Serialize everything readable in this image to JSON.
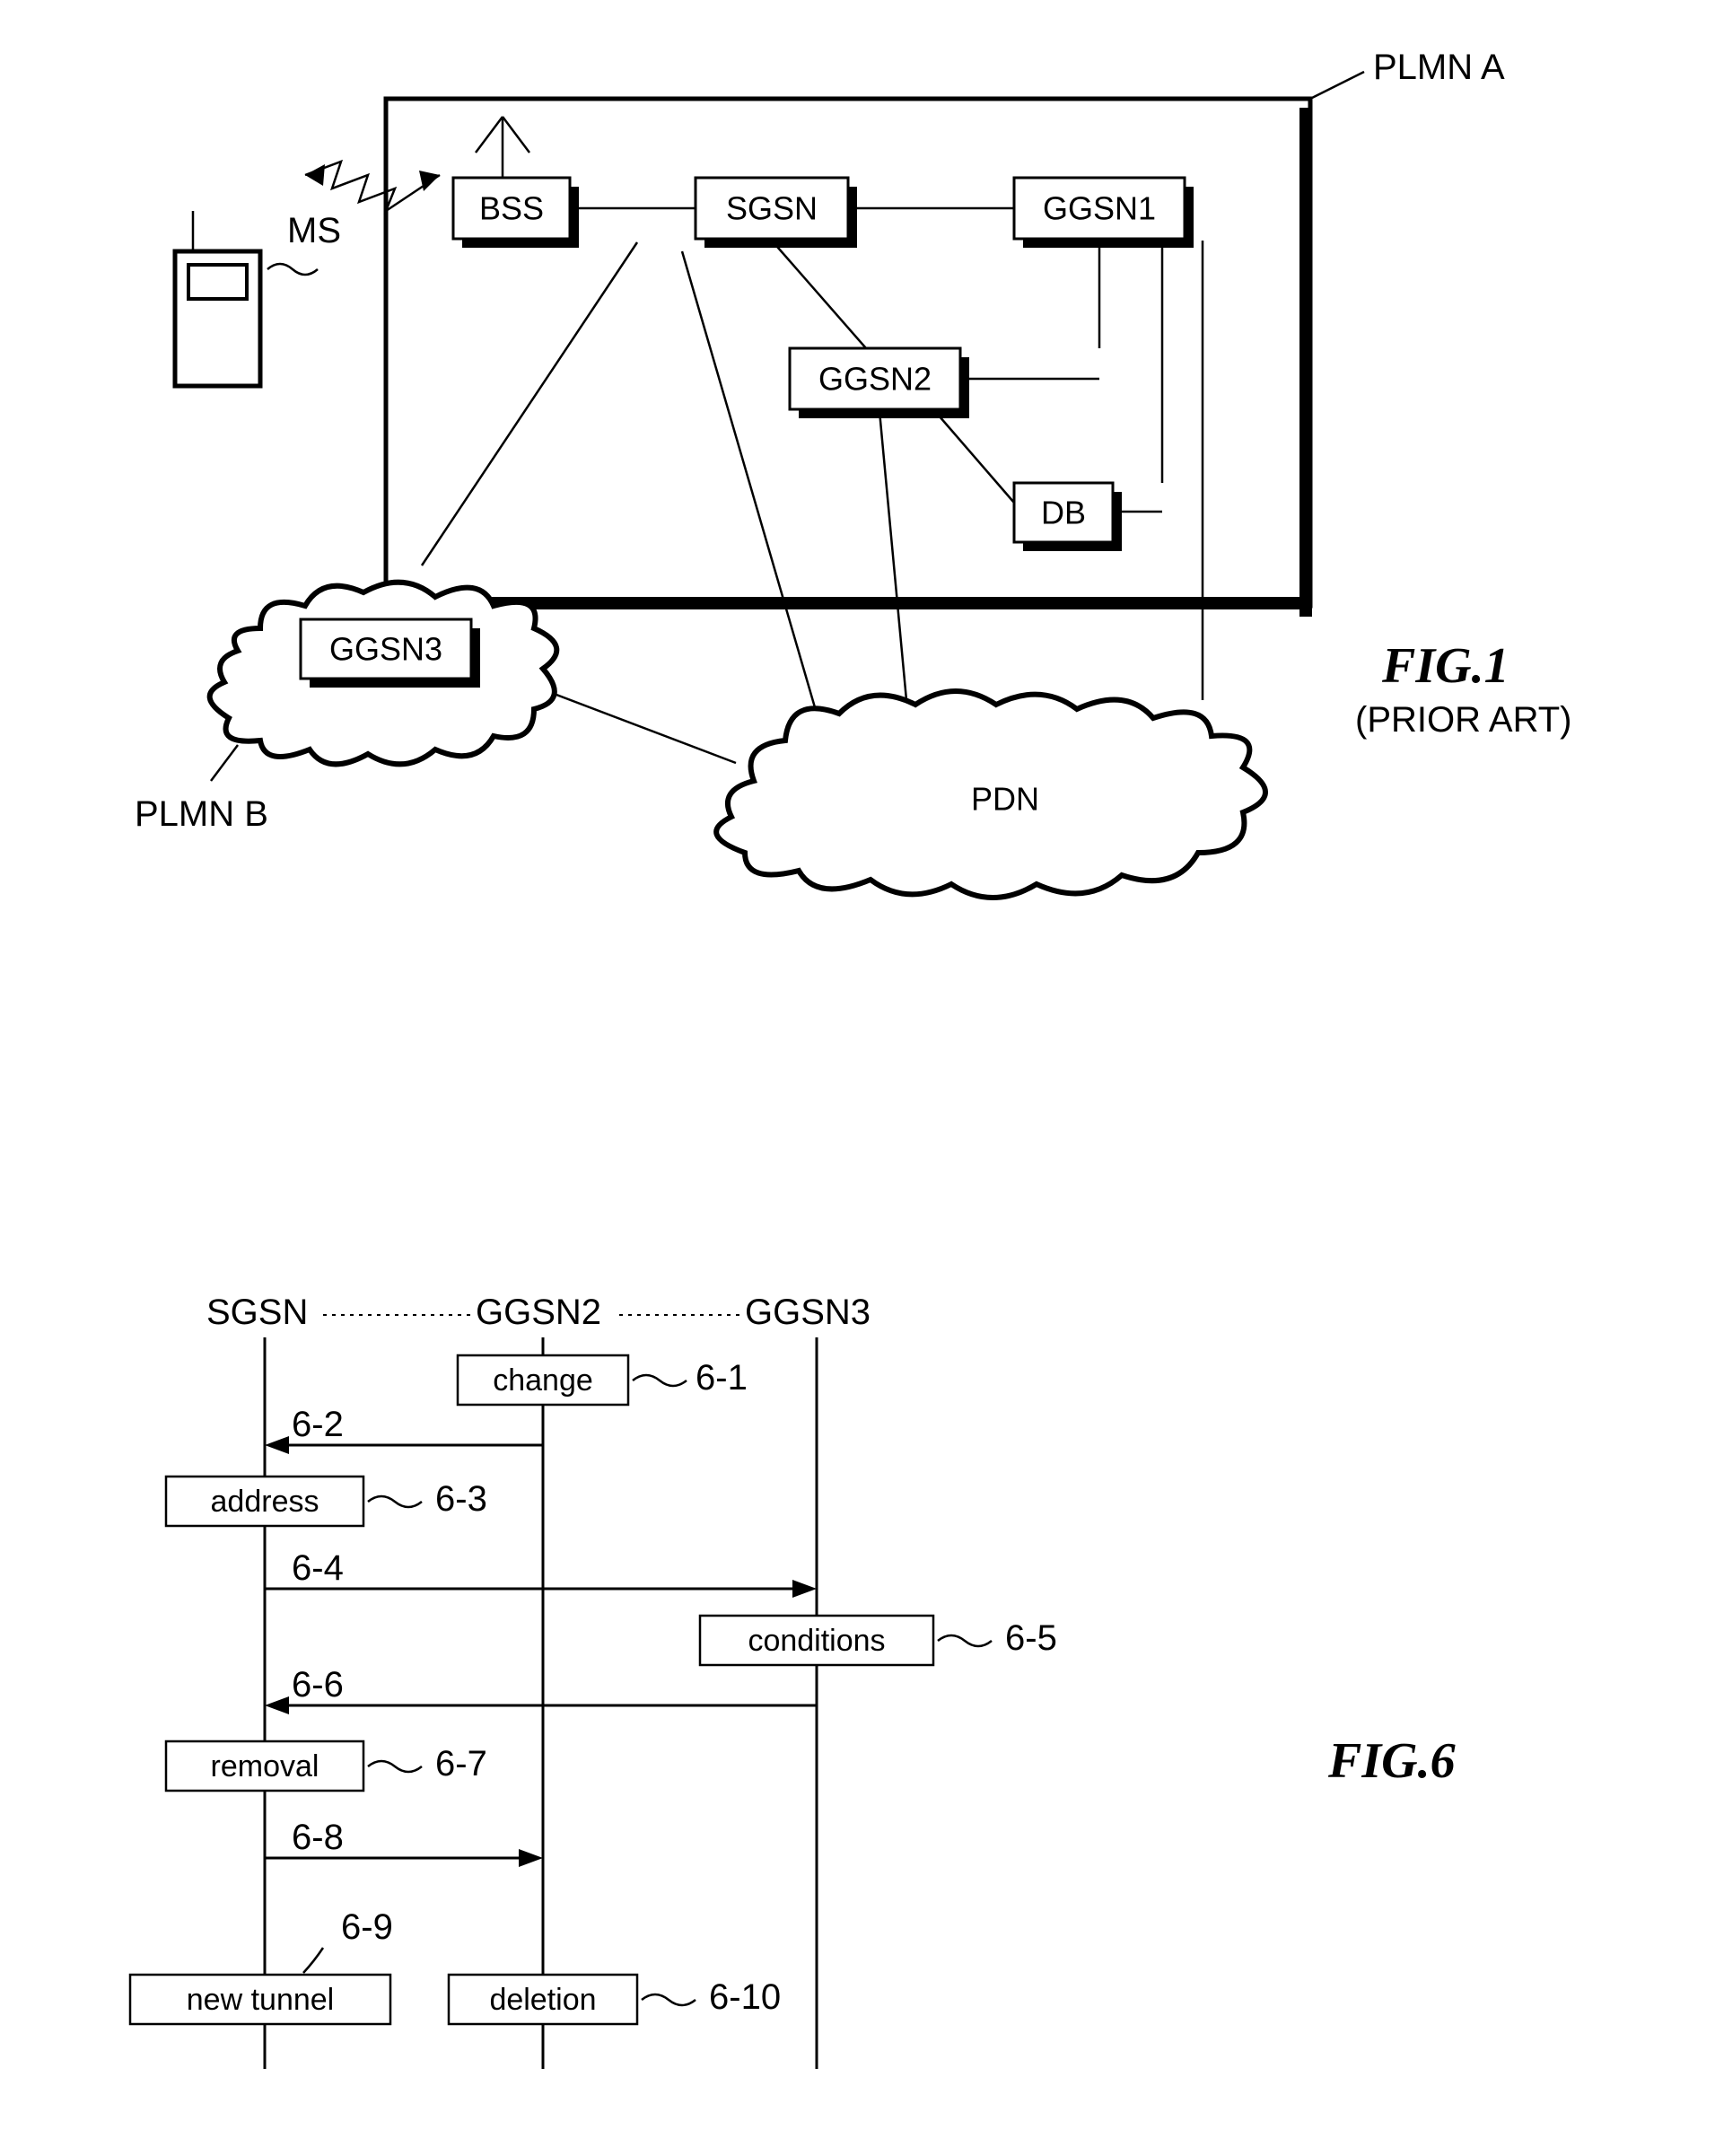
{
  "fig1": {
    "title": "FIG.1",
    "subtitle": "(PRIOR ART)",
    "labels": {
      "plmn_a": "PLMN A",
      "plmn_b": "PLMN B",
      "ms": "MS",
      "bss": "BSS",
      "sgsn": "SGSN",
      "ggsn1": "GGSN1",
      "ggsn2": "GGSN2",
      "ggsn3": "GGSN3",
      "db": "DB",
      "pdn": "PDN"
    }
  },
  "fig6": {
    "title": "FIG.6",
    "headers": {
      "sgsn": "SGSN",
      "ggsn2": "GGSN2",
      "ggsn3": "GGSN3"
    },
    "steps": {
      "s1": "change",
      "s3": "address",
      "s5": "conditions",
      "s7": "removal",
      "s9": "new tunnel",
      "s10": "deletion"
    },
    "nums": {
      "n1": "6-1",
      "n2": "6-2",
      "n3": "6-3",
      "n4": "6-4",
      "n5": "6-5",
      "n6": "6-6",
      "n7": "6-7",
      "n8": "6-8",
      "n9": "6-9",
      "n10": "6-10"
    }
  }
}
